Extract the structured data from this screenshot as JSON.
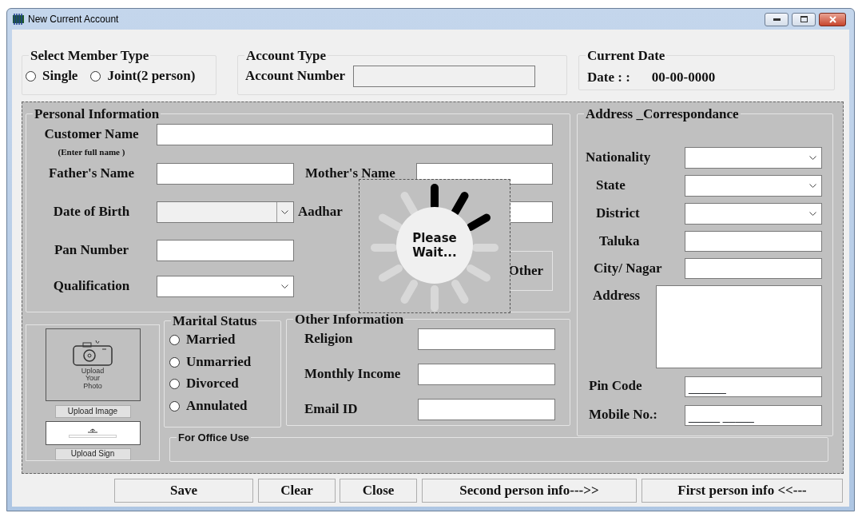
{
  "window": {
    "title": "New Current Account"
  },
  "member_type": {
    "title": "Select Member Type",
    "options": [
      {
        "label": "Single",
        "selected": false
      },
      {
        "label": "Joint(2 person)",
        "selected": false
      }
    ]
  },
  "account_type": {
    "title": "Account Type",
    "number_label": "Account Number"
  },
  "current_date": {
    "title": "Current Date",
    "label": "Date : :",
    "value": "00-00-0000"
  },
  "personal_information": {
    "title": "Personal Information",
    "customer_name_label": "Customer Name",
    "customer_name_hint": "(Enter full name )",
    "fathers_name_label": "Father's Name",
    "mothers_name_label": "Mother's Name",
    "date_of_birth_label": "Date of Birth",
    "date_of_birth_disabled": true,
    "aadhar_label": "Aadhar",
    "pan_number_label": "Pan Number",
    "qualification_label": "Qualification",
    "other_label": "Other"
  },
  "photo": {
    "photo_text": "Upload Your Photo",
    "upload_image_button": "Upload Image",
    "upload_sign_button": "Upload Sign"
  },
  "marital_status": {
    "title": "Marital Status",
    "options": [
      {
        "label": "Married",
        "selected": false
      },
      {
        "label": "Unmarried",
        "selected": false
      },
      {
        "label": "Divorced",
        "selected": false
      },
      {
        "label": "Annulated",
        "selected": false
      }
    ]
  },
  "other_information": {
    "title": "Other Information",
    "fields": [
      {
        "label": "Religion"
      },
      {
        "label": "Monthly Income"
      },
      {
        "label": "Email ID"
      }
    ]
  },
  "address": {
    "title": "Address _Correspondance",
    "fields": [
      {
        "label": "Nationality",
        "kind": "combo"
      },
      {
        "label": "State",
        "kind": "combo"
      },
      {
        "label": "District",
        "kind": "combo"
      },
      {
        "label": "Taluka",
        "kind": "text"
      },
      {
        "label": "City/ Nagar",
        "kind": "text"
      },
      {
        "label": "Address",
        "kind": "textarea"
      },
      {
        "label": "Pin Code",
        "kind": "text",
        "value": "______"
      },
      {
        "label": "Mobile No.:",
        "kind": "text",
        "value": "_____ _____"
      }
    ]
  },
  "office_use": {
    "title": "For Office Use"
  },
  "loading": {
    "text": "Please Wait..."
  },
  "buttons": [
    "Save",
    "Clear",
    "Close",
    "Second person info--->>",
    "First person info <<---"
  ]
}
